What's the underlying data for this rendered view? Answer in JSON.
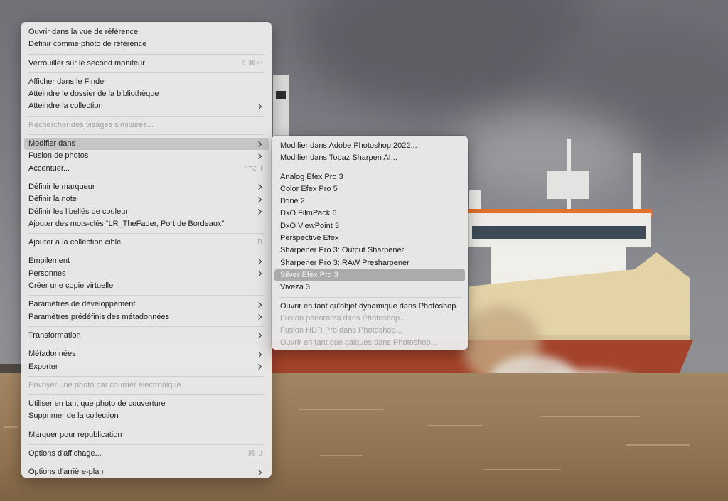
{
  "main_menu": [
    {
      "type": "item",
      "name": "menu-item-open-reference-view",
      "label": "Ouvrir dans la vue de référence"
    },
    {
      "type": "item",
      "name": "menu-item-set-reference-photo",
      "label": "Définir comme photo de référence"
    },
    {
      "type": "sep"
    },
    {
      "type": "item",
      "name": "menu-item-lock-second-monitor",
      "label": "Verrouiller sur le second moniteur",
      "shortcut": "⇧⌘↩"
    },
    {
      "type": "sep"
    },
    {
      "type": "item",
      "name": "menu-item-show-in-finder",
      "label": "Afficher dans le Finder"
    },
    {
      "type": "item",
      "name": "menu-item-go-to-library-folder",
      "label": "Atteindre le dossier de la bibliothèque"
    },
    {
      "type": "item",
      "name": "menu-item-go-to-collection",
      "label": "Atteindre la collection",
      "submenu": true
    },
    {
      "type": "sep"
    },
    {
      "type": "item",
      "name": "menu-item-find-similar-faces",
      "label": "Rechercher des visages similaires...",
      "disabled": true
    },
    {
      "type": "sep"
    },
    {
      "type": "item",
      "name": "menu-item-edit-in",
      "label": "Modifier dans",
      "submenu": true,
      "highlight": true
    },
    {
      "type": "item",
      "name": "menu-item-photo-merge",
      "label": "Fusion de photos",
      "submenu": true
    },
    {
      "type": "item",
      "name": "menu-item-enhance",
      "label": "Accentuer...",
      "shortcut": "^⌥ I"
    },
    {
      "type": "sep"
    },
    {
      "type": "item",
      "name": "menu-item-set-flag",
      "label": "Définir le marqueur",
      "submenu": true
    },
    {
      "type": "item",
      "name": "menu-item-set-rating",
      "label": "Définir la note",
      "submenu": true
    },
    {
      "type": "item",
      "name": "menu-item-set-color-label",
      "label": "Définir les libellés de couleur",
      "submenu": true
    },
    {
      "type": "item",
      "name": "menu-item-add-keywords",
      "label": "Ajouter des mots-clés “LR_TheFader, Port de Bordeaux”"
    },
    {
      "type": "sep"
    },
    {
      "type": "item",
      "name": "menu-item-add-to-target-collection",
      "label": "Ajouter à la collection cible",
      "shortcut": "B"
    },
    {
      "type": "sep"
    },
    {
      "type": "item",
      "name": "menu-item-stacking",
      "label": "Empilement",
      "submenu": true
    },
    {
      "type": "item",
      "name": "menu-item-people",
      "label": "Personnes",
      "submenu": true
    },
    {
      "type": "item",
      "name": "menu-item-create-virtual-copy",
      "label": "Créer une copie virtuelle"
    },
    {
      "type": "sep"
    },
    {
      "type": "item",
      "name": "menu-item-develop-settings",
      "label": "Paramètres de développement",
      "submenu": true
    },
    {
      "type": "item",
      "name": "menu-item-metadata-presets",
      "label": "Paramètres prédéfinis des métadonnées",
      "submenu": true
    },
    {
      "type": "sep"
    },
    {
      "type": "item",
      "name": "menu-item-transform",
      "label": "Transformation",
      "submenu": true
    },
    {
      "type": "sep"
    },
    {
      "type": "item",
      "name": "menu-item-metadata",
      "label": "Métadonnées",
      "submenu": true
    },
    {
      "type": "item",
      "name": "menu-item-export",
      "label": "Exporter",
      "submenu": true
    },
    {
      "type": "sep"
    },
    {
      "type": "item",
      "name": "menu-item-email-photo",
      "label": "Envoyer une photo par courrier électronique...",
      "disabled": true
    },
    {
      "type": "sep"
    },
    {
      "type": "item",
      "name": "menu-item-use-as-cover",
      "label": "Utiliser en tant que photo de couverture"
    },
    {
      "type": "item",
      "name": "menu-item-remove-from-collection",
      "label": "Supprimer de la collection"
    },
    {
      "type": "sep"
    },
    {
      "type": "item",
      "name": "menu-item-mark-to-republish",
      "label": "Marquer pour republication"
    },
    {
      "type": "sep"
    },
    {
      "type": "item",
      "name": "menu-item-view-options",
      "label": "Options d'affichage...",
      "shortcut": "⌘ J"
    },
    {
      "type": "sep"
    },
    {
      "type": "item",
      "name": "menu-item-background-options",
      "label": "Options d'arrière-plan",
      "submenu": true
    }
  ],
  "sub_menu": [
    {
      "type": "item",
      "name": "submenu-item-photoshop-2022",
      "label": "Modifier dans Adobe Photoshop 2022..."
    },
    {
      "type": "item",
      "name": "submenu-item-topaz-sharpen",
      "label": "Modifier dans Topaz Sharpen AI..."
    },
    {
      "type": "sep"
    },
    {
      "type": "item",
      "name": "submenu-item-analog-efex",
      "label": "Analog Efex Pro 3"
    },
    {
      "type": "item",
      "name": "submenu-item-color-efex",
      "label": "Color Efex Pro 5"
    },
    {
      "type": "item",
      "name": "submenu-item-dfine",
      "label": "Dfine 2"
    },
    {
      "type": "item",
      "name": "submenu-item-dxo-filmpack",
      "label": "DxO FilmPack 6"
    },
    {
      "type": "item",
      "name": "submenu-item-dxo-viewpoint",
      "label": "DxO ViewPoint 3"
    },
    {
      "type": "item",
      "name": "submenu-item-perspective-efex",
      "label": "Perspective Efex"
    },
    {
      "type": "item",
      "name": "submenu-item-sharpener-output",
      "label": "Sharpener Pro 3: Output Sharpener"
    },
    {
      "type": "item",
      "name": "submenu-item-sharpener-raw",
      "label": "Sharpener Pro 3: RAW Presharpener"
    },
    {
      "type": "item",
      "name": "submenu-item-silver-efex",
      "label": "Silver Efex Pro 3",
      "selected": true
    },
    {
      "type": "item",
      "name": "submenu-item-viveza",
      "label": "Viveza 3"
    },
    {
      "type": "sep"
    },
    {
      "type": "item",
      "name": "submenu-item-smart-object",
      "label": "Ouvrir en tant qu'objet dynamique dans Photoshop..."
    },
    {
      "type": "item",
      "name": "submenu-item-panorama",
      "label": "Fusion panorama dans Photoshop...",
      "disabled": true
    },
    {
      "type": "item",
      "name": "submenu-item-hdr-pro",
      "label": "Fusion HDR Pro dans Photoshop...",
      "disabled": true
    },
    {
      "type": "item",
      "name": "submenu-item-layers",
      "label": "Ouvrir en tant que calques dans Photoshop...",
      "disabled": true
    }
  ]
}
